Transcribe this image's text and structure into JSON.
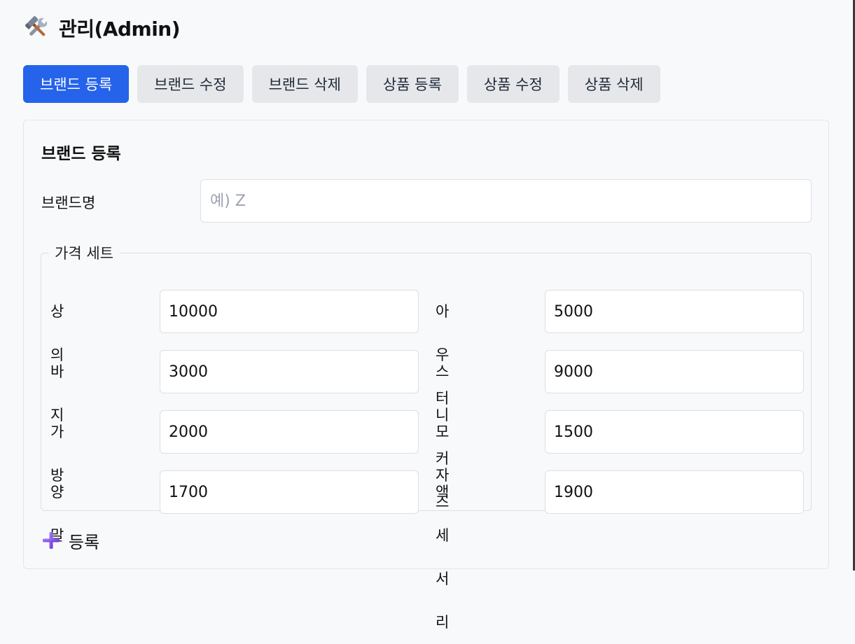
{
  "header": {
    "icon": "hammer-and-wrench-icon",
    "title": "관리(Admin)"
  },
  "tabs": [
    {
      "label": "브랜드 등록",
      "active": true
    },
    {
      "label": "브랜드 수정",
      "active": false
    },
    {
      "label": "브랜드 삭제",
      "active": false
    },
    {
      "label": "상품 등록",
      "active": false
    },
    {
      "label": "상품 수정",
      "active": false
    },
    {
      "label": "상품 삭제",
      "active": false
    }
  ],
  "form": {
    "title": "브랜드 등록",
    "brand_label": "브랜드명",
    "brand_placeholder": "예) Z",
    "brand_value": "",
    "price_set_legend": "가격 세트",
    "prices": [
      {
        "label": "상의",
        "value": "10000"
      },
      {
        "label": "아우터",
        "value": "5000"
      },
      {
        "label": "바지",
        "value": "3000"
      },
      {
        "label": "스니커즈",
        "value": "9000"
      },
      {
        "label": "가방",
        "value": "2000"
      },
      {
        "label": "모자",
        "value": "1500"
      },
      {
        "label": "양말",
        "value": "1700"
      },
      {
        "label": "액세서리",
        "value": "1900"
      }
    ],
    "submit_label": "등록",
    "submit_icon": "plus-icon"
  },
  "colors": {
    "accent": "#2563eb",
    "tab_inactive": "#e5e7eb",
    "background": "#f8f9fb",
    "plus_icon": "#8b5cf6"
  }
}
